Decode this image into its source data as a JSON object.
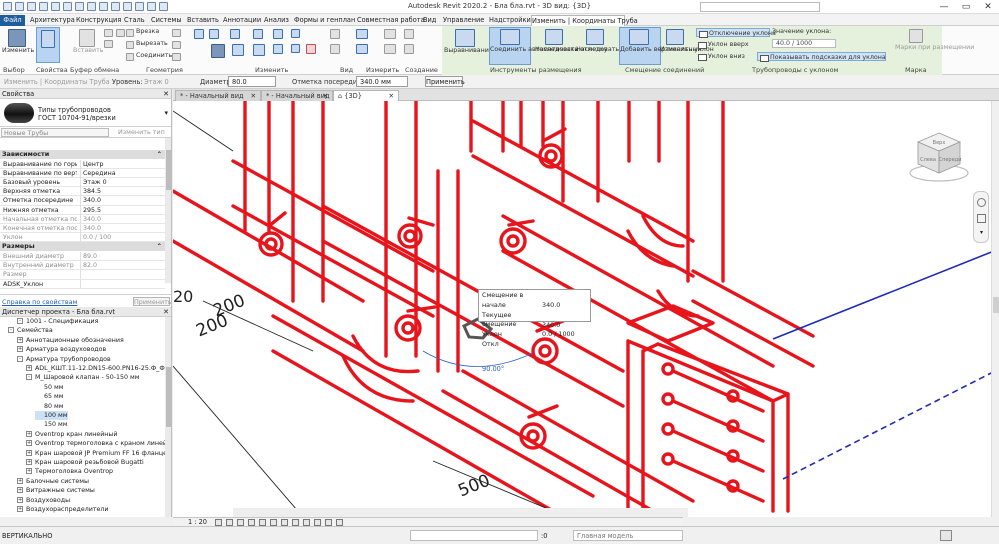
{
  "app": {
    "title": "Autodesk Revit 2020.2 - Бла бла.rvt - 3D вид: {3D}"
  },
  "window": {
    "minimize": "—",
    "restore": "▭",
    "close": "✕"
  },
  "ribbon_tabs": [
    "Файл",
    "Архитектура",
    "Конструкция",
    "Сталь",
    "Системы",
    "Вставить",
    "Аннотации",
    "Анализ",
    "Формы и генплан",
    "Совместная работа",
    "Вид",
    "Управление",
    "Надстройки",
    "Изменить | Координаты Труба"
  ],
  "ribbon": {
    "modify": "Изменить",
    "select": "Выбор",
    "properties": "Свойства",
    "paste": "Вставить",
    "clipboard": "Буфер обмена",
    "cut": "Врезка",
    "trim": "Вырезать",
    "join": "Соединить",
    "geometry": "Геометрия",
    "modify_panel": "Изменить",
    "view": "Вид",
    "measure": "Измерить",
    "create": "Создание",
    "justify": "Выравнивание",
    "auto_connect": "Соединить автоматически",
    "inherit_elev": "Наследовать отметку",
    "inherit_size": "Наследовать размер",
    "placement_tools": "Инструменты размещения",
    "add_vertical": "Добавить вертикальный",
    "change_slope": "Изменить уклон",
    "offset_connections": "Смещение соединений",
    "slope_off": "Отключение уклона",
    "slope_up": "Уклон вверх",
    "slope_down": "Уклон вниз",
    "slope_value_label": "Значение уклона:",
    "slope_value": "40.0 / 1000",
    "show_slope_tooltip": "Показывать подсказки для уклона",
    "pipes_with_slope": "Трубопроводы с уклоном",
    "tag_on_place": "Марки при размещении",
    "tag": "Марка"
  },
  "options_bar": {
    "modify_label": "Изменить | Координаты Труба",
    "level_label": "Уровень:",
    "level_value": "Этаж 0",
    "diameter_label": "Диаметр:",
    "diameter_value": "80.0",
    "middle_elev_label": "Отметка посередине:",
    "middle_elev_value": "340.0 мм",
    "apply": "Применить"
  },
  "properties": {
    "header": "Свойства",
    "type_line1": "Типы трубопроводов",
    "type_line2": "ГОСТ 10704-91/врезки",
    "instance_label": "Новые Трубы",
    "edit_type": "Изменить тип",
    "groups": [
      {
        "name": "Зависимости",
        "rows": [
          {
            "k": "Выравнивание по гориз...",
            "v": "Центр",
            "dis": false
          },
          {
            "k": "Выравнивание по верти...",
            "v": "Середина",
            "dis": false
          },
          {
            "k": "Базовый уровень",
            "v": "Этаж 0",
            "dis": false
          },
          {
            "k": "Верхняя отметка",
            "v": "384.5",
            "dis": false
          },
          {
            "k": "Отметка посередине",
            "v": "340.0",
            "dis": false
          },
          {
            "k": "Нижняя отметка",
            "v": "295.5",
            "dis": false
          },
          {
            "k": "Начальная отметка пос...",
            "v": "340.0",
            "dis": true
          },
          {
            "k": "Конечная отметка посе...",
            "v": "340.0",
            "dis": true
          },
          {
            "k": "Уклон",
            "v": "0.0 / 100",
            "dis": true
          }
        ]
      },
      {
        "name": "Размеры",
        "rows": [
          {
            "k": "Внешний диаметр",
            "v": "89.0",
            "dis": true
          },
          {
            "k": "Внутренний диаметр",
            "v": "82.0",
            "dis": true
          },
          {
            "k": "Размер",
            "v": "",
            "dis": true
          },
          {
            "k": "ADSK_Уклон",
            "v": "",
            "dis": false
          }
        ]
      }
    ],
    "help": "Справка по свойствам",
    "apply": "Применить"
  },
  "browser": {
    "header": "Диспетчер проекта - Бла бла.rvt",
    "items": [
      {
        "label": "1001 - Спецификация",
        "level": 1,
        "toggle": "-",
        "sel": false
      },
      {
        "label": "Семейства",
        "level": 0,
        "toggle": "-",
        "sel": false
      },
      {
        "label": "Аннотационные обозначения",
        "level": 1,
        "toggle": "+",
        "sel": false
      },
      {
        "label": "Арматура воздуховодов",
        "level": 1,
        "toggle": "+",
        "sel": false
      },
      {
        "label": "Арматура трубопроводов",
        "level": 1,
        "toggle": "-",
        "sel": false
      },
      {
        "label": "ADL_КШТ.11-12.DN15-600.PN16-25.Ф_Ф",
        "level": 2,
        "toggle": "+",
        "sel": false
      },
      {
        "label": "М_Шаровой клапан - 50-150 мм",
        "level": 2,
        "toggle": "-",
        "sel": false
      },
      {
        "label": "50 мм",
        "level": 3,
        "toggle": "",
        "sel": false
      },
      {
        "label": "65 мм",
        "level": 3,
        "toggle": "",
        "sel": false
      },
      {
        "label": "80 мм",
        "level": 3,
        "toggle": "",
        "sel": false
      },
      {
        "label": "100 мм",
        "level": 3,
        "toggle": "",
        "sel": true
      },
      {
        "label": "150 мм",
        "level": 3,
        "toggle": "",
        "sel": false
      },
      {
        "label": "Oventrop кран линейный",
        "level": 2,
        "toggle": "+",
        "sel": false
      },
      {
        "label": "Oventrop термоголовка с краном линейная",
        "level": 2,
        "toggle": "+",
        "sel": false
      },
      {
        "label": "Кран шаровой JP Premium FF 16 фланцевый",
        "level": 2,
        "toggle": "+",
        "sel": false
      },
      {
        "label": "Кран шаровой резьбовой Bugatti",
        "level": 2,
        "toggle": "+",
        "sel": false
      },
      {
        "label": "Термоголовка Oventrop",
        "level": 2,
        "toggle": "+",
        "sel": false
      },
      {
        "label": "Балочные системы",
        "level": 1,
        "toggle": "+",
        "sel": false
      },
      {
        "label": "Витражные системы",
        "level": 1,
        "toggle": "+",
        "sel": false
      },
      {
        "label": "Воздуховоды",
        "level": 1,
        "toggle": "+",
        "sel": false
      },
      {
        "label": "Воздухораспределители",
        "level": 1,
        "toggle": "+",
        "sel": false
      }
    ]
  },
  "view_tabs": [
    {
      "label": "* - Начальный вид",
      "active": false
    },
    {
      "label": "* - Начальный вид",
      "active": false
    },
    {
      "label": "{3D}",
      "active": true
    }
  ],
  "tooltip": {
    "rows": [
      {
        "k": "Смещение в начале",
        "v": "340.0"
      },
      {
        "k": "Текущее смещение",
        "v": "340.0"
      },
      {
        "k": "Уклон",
        "v": "0.0 / 1000 Откл"
      }
    ]
  },
  "angle": "90.00°",
  "dims": [
    "200",
    "200",
    "500",
    "500",
    "20",
    "0"
  ],
  "viewcube": {
    "faces": [
      "Верх",
      "Слева",
      "Спереди"
    ]
  },
  "view_scale": "1 : 20",
  "status": {
    "text": "ВЕРТИКАЛЬНО",
    "model": "Главная модель",
    "coord": ":0"
  },
  "colors": {
    "pipe_red": "#e8141c",
    "accent_blue": "#1f5c9c",
    "context_green": "#e6f1dd",
    "dim_blue": "#1f2bb8"
  }
}
